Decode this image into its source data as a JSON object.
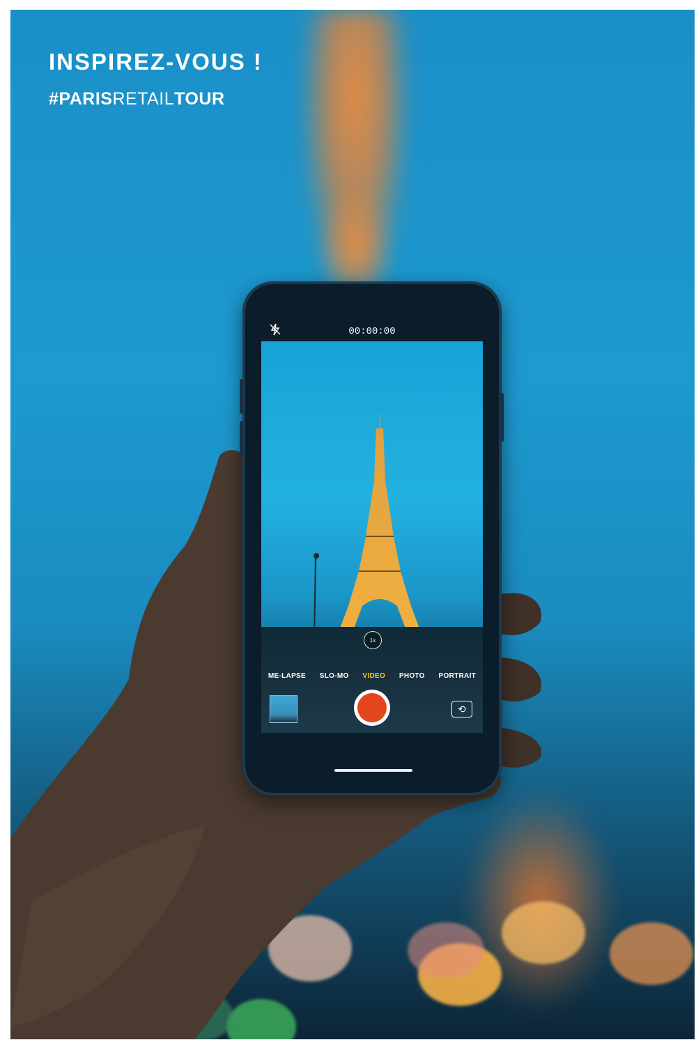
{
  "header": {
    "headline": "INSPIREZ-VOUS !",
    "hashtag_prefix": "#",
    "hashtag_part1": "PARIS",
    "hashtag_part2": "RETAIL",
    "hashtag_part3": "TOUR"
  },
  "camera": {
    "timer": "00:00:00",
    "zoom": "1x",
    "modes": [
      "ME-LAPSE",
      "SLO-MO",
      "VIDEO",
      "PHOTO",
      "PORTRAIT"
    ],
    "active_mode": "VIDEO",
    "flash_icon": "flash-off-icon",
    "flip_icon": "camera-flip-icon"
  },
  "colors": {
    "sky": "#1d9ad0",
    "tower_glow": "#f08c3c",
    "shutter": "#e3461c",
    "active_mode": "#ffcc00",
    "text": "#ffffff"
  }
}
